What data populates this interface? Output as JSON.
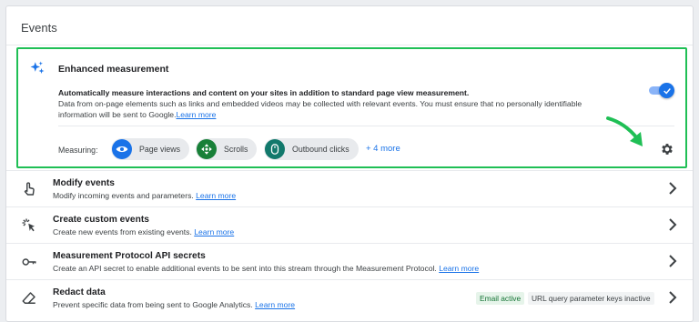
{
  "section": {
    "title": "Events"
  },
  "enhanced": {
    "title": "Enhanced measurement",
    "desc_bold": "Automatically measure interactions and content on your sites in addition to standard page view measurement.",
    "desc_rest": "Data from on-page elements such as links and embedded videos may be collected with relevant events. You must ensure that no personally identifiable information will be sent to Google.",
    "learn_more": "Learn more",
    "toggle_on": true,
    "measuring_label": "Measuring:",
    "chips": [
      "Page views",
      "Scrolls",
      "Outbound clicks"
    ],
    "more": "+ 4 more",
    "colors": {
      "highlight": "#1fbf55",
      "page_views": "#1a73e8",
      "scrolls": "#188038",
      "outbound": "#12796c"
    }
  },
  "rows": [
    {
      "title": "Modify events",
      "desc": "Modify incoming events and parameters.",
      "link": "Learn more",
      "icon": "touch-icon"
    },
    {
      "title": "Create custom events",
      "desc": "Create new events from existing events.",
      "link": "Learn more",
      "icon": "sparkle-click-icon"
    },
    {
      "title": "Measurement Protocol API secrets",
      "desc": "Create an API secret to enable additional events to be sent into this stream through the Measurement Protocol.",
      "link": "Learn more",
      "icon": "key-icon"
    },
    {
      "title": "Redact data",
      "desc": "Prevent specific data from being sent to Google Analytics.",
      "link": "Learn more",
      "icon": "eraser-icon",
      "badges": [
        "Email active",
        "URL query parameter keys inactive"
      ]
    }
  ]
}
